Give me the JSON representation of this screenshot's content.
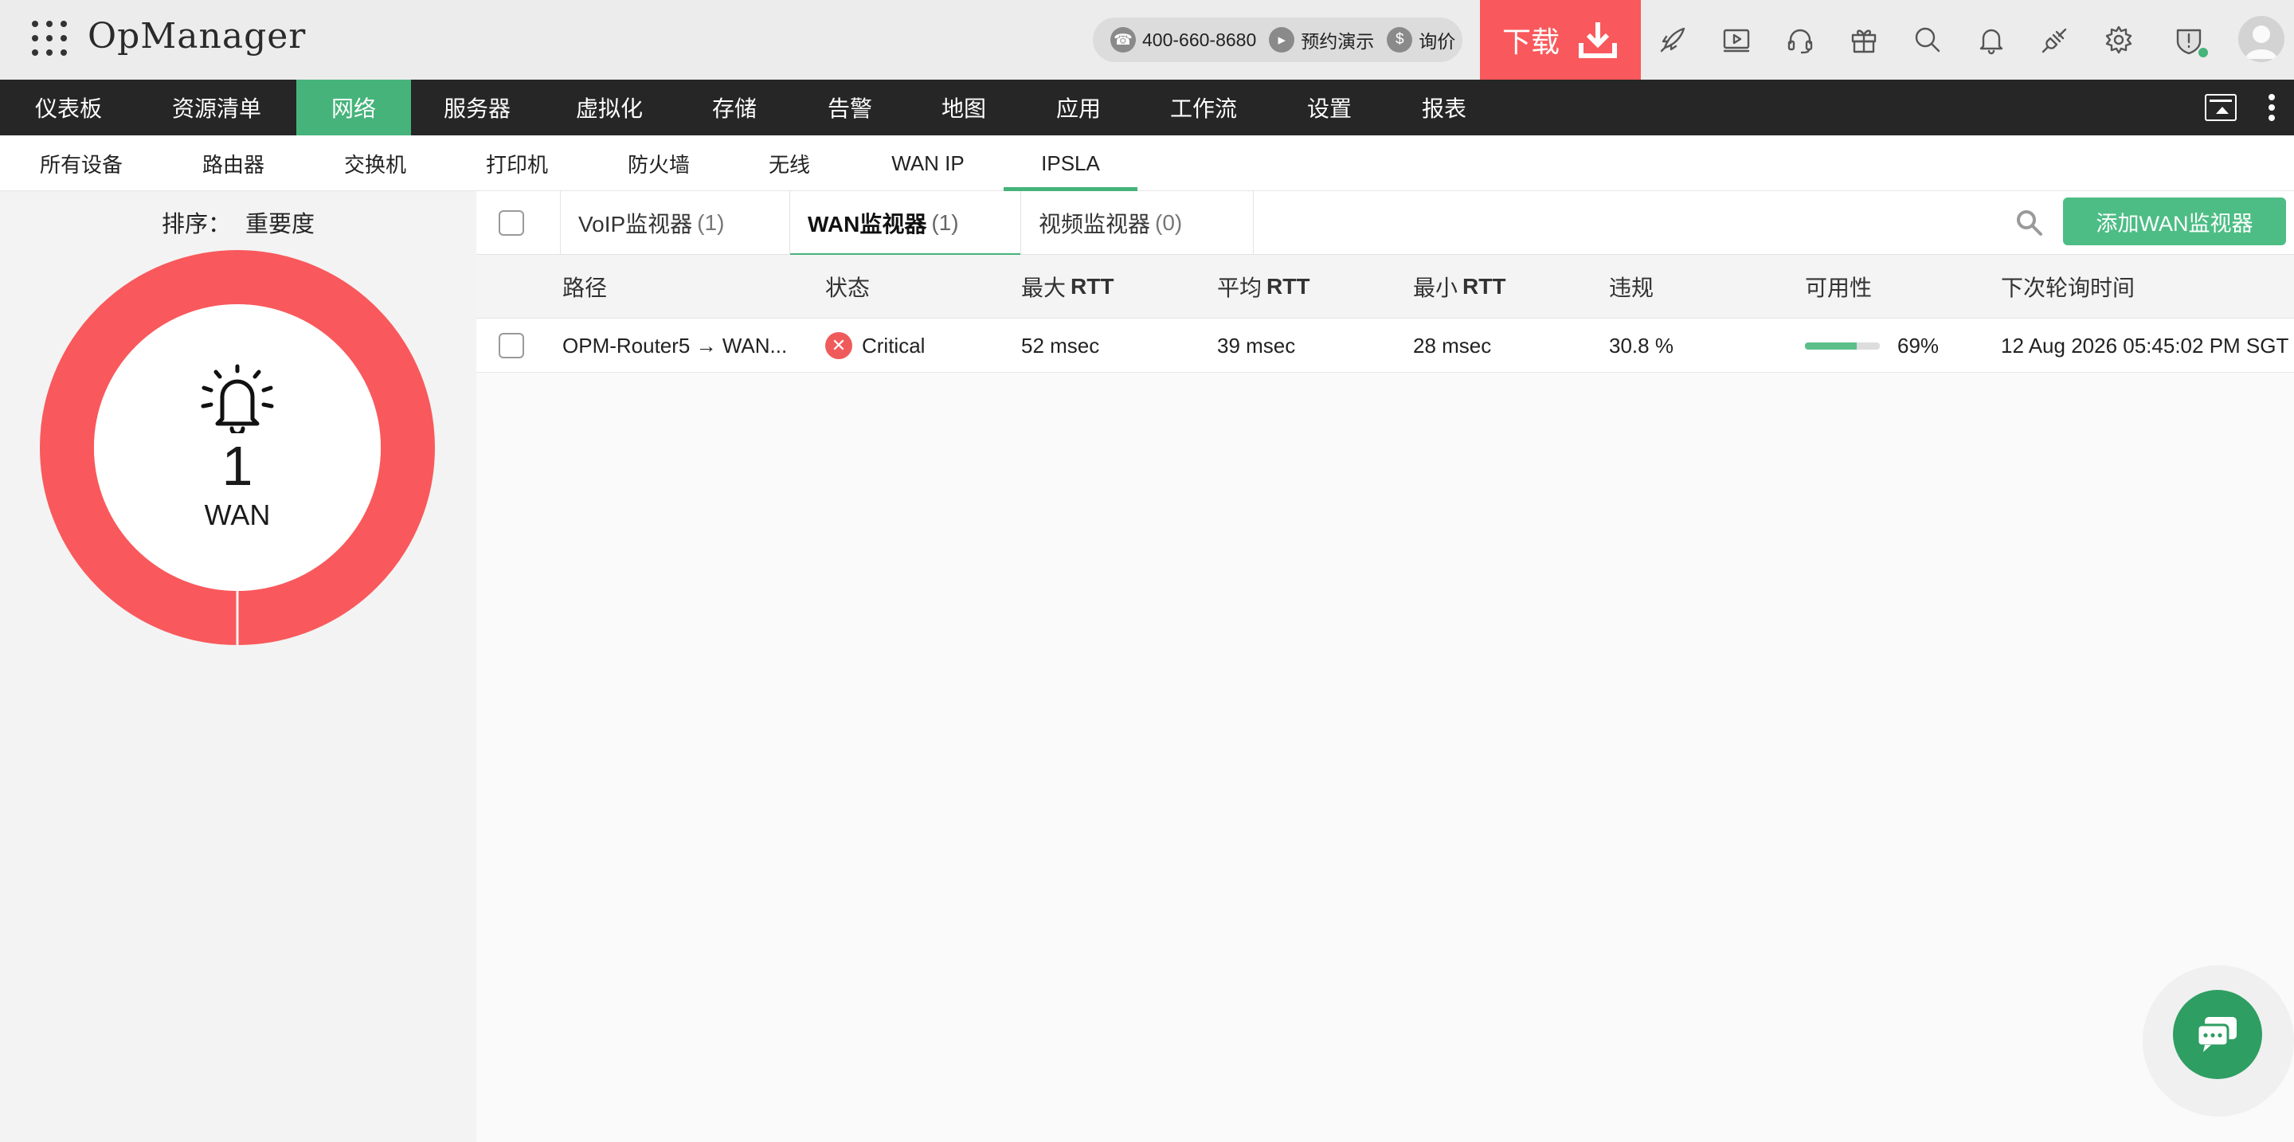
{
  "header": {
    "app_name": "OpManager",
    "phone": "400-660-8680",
    "demo_label": "预约演示",
    "price_label": "询价",
    "download_label": "下载",
    "icons": [
      "rocket-icon",
      "video-icon",
      "headset-icon",
      "gift-icon",
      "search-icon",
      "bell-icon",
      "plug-icon",
      "gear-icon",
      "shield-alert-icon",
      "avatar"
    ],
    "brand_color": "#f9595c"
  },
  "mainnav": {
    "items": [
      {
        "label": "仪表板"
      },
      {
        "label": "资源清单"
      },
      {
        "label": "网络"
      },
      {
        "label": "服务器"
      },
      {
        "label": "虚拟化"
      },
      {
        "label": "存储"
      },
      {
        "label": "告警"
      },
      {
        "label": "地图"
      },
      {
        "label": "应用"
      },
      {
        "label": "工作流"
      },
      {
        "label": "设置"
      },
      {
        "label": "报表"
      }
    ],
    "active": "网络",
    "active_color": "#46b37b"
  },
  "subnav": {
    "items": [
      {
        "label": "所有设备"
      },
      {
        "label": "路由器"
      },
      {
        "label": "交换机"
      },
      {
        "label": "打印机"
      },
      {
        "label": "防火墙"
      },
      {
        "label": "无线"
      },
      {
        "label": "WAN IP"
      },
      {
        "label": "IPSLA"
      }
    ],
    "active": "IPSLA"
  },
  "left": {
    "sort_label": "排序：",
    "sort_value": "重要度",
    "donut_count": "1",
    "donut_label": "WAN",
    "donut_color": "#f9595c"
  },
  "tabs": [
    {
      "label": "VoIP监视器",
      "count": "(1)"
    },
    {
      "label": "WAN监视器",
      "count": "(1)"
    },
    {
      "label": "视频监视器",
      "count": "(0)"
    }
  ],
  "active_tab": "WAN监视器",
  "add_button": "添加WAN监视器",
  "columns": [
    {
      "label": "路径",
      "suffix": ""
    },
    {
      "label": "状态",
      "suffix": ""
    },
    {
      "label": "最大",
      "suffix": "RTT"
    },
    {
      "label": "平均",
      "suffix": "RTT"
    },
    {
      "label": "最小",
      "suffix": "RTT"
    },
    {
      "label": "违规",
      "suffix": ""
    },
    {
      "label": "可用性",
      "suffix": ""
    },
    {
      "label": "下次轮询时间",
      "suffix": ""
    }
  ],
  "rows": [
    {
      "path": "OPM-Router5 → WAN...",
      "status": "Critical",
      "status_color": "#ef5b5b",
      "max_rtt": "52 msec",
      "avg_rtt": "39 msec",
      "min_rtt": "28 msec",
      "violation": "30.8 %",
      "availability": "69%",
      "availability_fraction": 0.69,
      "next_poll": "12 Aug 2026 05:45:02 PM SGT"
    }
  ]
}
